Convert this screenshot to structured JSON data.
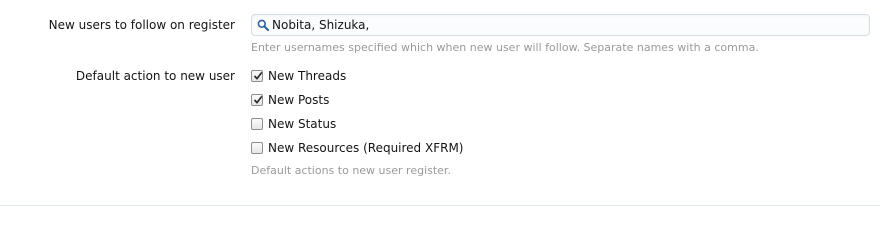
{
  "form": {
    "follow_label": "New users to follow on register",
    "follow_value": "Nobita, Shizuka,",
    "follow_hint": "Enter usernames specified which when new user will follow. Separate names with a comma.",
    "default_label": "Default action to new user",
    "default_hint": "Default actions to new user register.",
    "options": [
      {
        "label": "New Threads",
        "checked": true
      },
      {
        "label": "New Posts",
        "checked": true
      },
      {
        "label": "New Status",
        "checked": false
      },
      {
        "label": "New Resources (Required XFRM)",
        "checked": false
      }
    ]
  },
  "icons": {
    "search": "search-icon",
    "check": "checkmark-icon"
  },
  "colors": {
    "hint": "#9a9a9a",
    "input_border": "#d7dde5",
    "icon_blue": "#2b5f9e"
  }
}
